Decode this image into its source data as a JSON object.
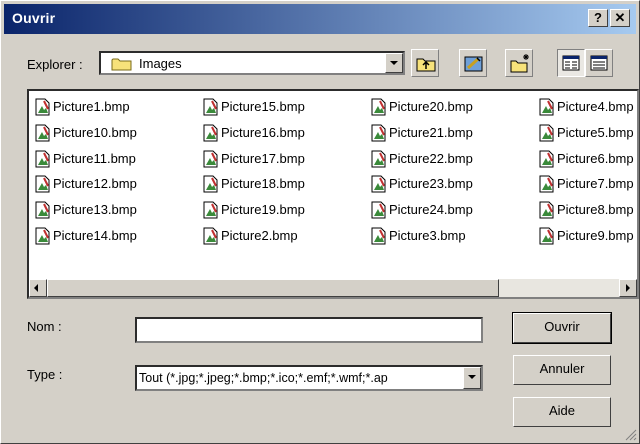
{
  "title": "Ouvrir",
  "titlebar_buttons": {
    "help": "?",
    "close": "✕"
  },
  "lookin": {
    "label": "Explorer :",
    "value": "Images"
  },
  "toolbar": {
    "up_icon": "up-folder-icon",
    "desktop_icon": "desktop-icon",
    "new_folder_icon": "new-folder-icon",
    "list_icon": "list-view-icon",
    "details_icon": "details-view-icon"
  },
  "files": {
    "col1": [
      "Picture1.bmp",
      "Picture10.bmp",
      "Picture11.bmp",
      "Picture12.bmp",
      "Picture13.bmp",
      "Picture14.bmp"
    ],
    "col2": [
      "Picture15.bmp",
      "Picture16.bmp",
      "Picture17.bmp",
      "Picture18.bmp",
      "Picture19.bmp",
      "Picture2.bmp"
    ],
    "col3": [
      "Picture20.bmp",
      "Picture21.bmp",
      "Picture22.bmp",
      "Picture23.bmp",
      "Picture24.bmp",
      "Picture3.bmp"
    ],
    "col4": [
      "Picture4.bmp",
      "Picture5.bmp",
      "Picture6.bmp",
      "Picture7.bmp",
      "Picture8.bmp",
      "Picture9.bmp"
    ]
  },
  "name_field": {
    "label": "Nom :",
    "value": ""
  },
  "type_field": {
    "label": "Type :",
    "value": "Tout (*.jpg;*.jpeg;*.bmp;*.ico;*.emf;*.wmf;*.ap"
  },
  "buttons": {
    "open": "Ouvrir",
    "cancel": "Annuler",
    "help": "Aide"
  },
  "colors": {
    "title_start": "#0a246a",
    "title_end": "#a6caf0",
    "face": "#d4d0c8"
  }
}
